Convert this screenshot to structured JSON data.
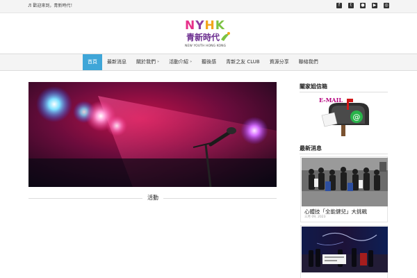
{
  "topbar": {
    "welcome": "歡迎來到，青新時代！",
    "social_icons": [
      "facebook-icon",
      "twitter-icon",
      "flickr-icon",
      "youtube-icon",
      "instagram-icon"
    ]
  },
  "logo": {
    "letters": [
      "N",
      "Y",
      "H",
      "K"
    ],
    "letter_colors": [
      "#e7308a",
      "#8b3fa0",
      "#f2a51a",
      "#7cc242"
    ],
    "chinese": "青新時代",
    "english": "NEW YOUTH HONG KONG"
  },
  "nav": {
    "items": [
      {
        "label": "首頁",
        "active": true,
        "caret": ""
      },
      {
        "label": "最新消息",
        "active": false,
        "caret": ""
      },
      {
        "label": "關於我們",
        "active": false,
        "caret": "»"
      },
      {
        "label": "活動介紹",
        "active": false,
        "caret": "»"
      },
      {
        "label": "聽後感",
        "active": false,
        "caret": ""
      },
      {
        "label": "青新之友 CLUB",
        "active": false,
        "caret": ""
      },
      {
        "label": "資源分享",
        "active": false,
        "caret": ""
      },
      {
        "label": "聯絡我們",
        "active": false,
        "caret": ""
      }
    ],
    "accent_color": "#3fa6d8"
  },
  "main": {
    "hero_caption": "活動"
  },
  "sidebar": {
    "mailbox_title": "關家姐信箱",
    "mailbox_word": "E-MAIL",
    "news_title": "最新消息",
    "news": [
      {
        "title": "心體技「全能健兒」大挑戰",
        "date": "三月 09, 2023"
      }
    ]
  }
}
